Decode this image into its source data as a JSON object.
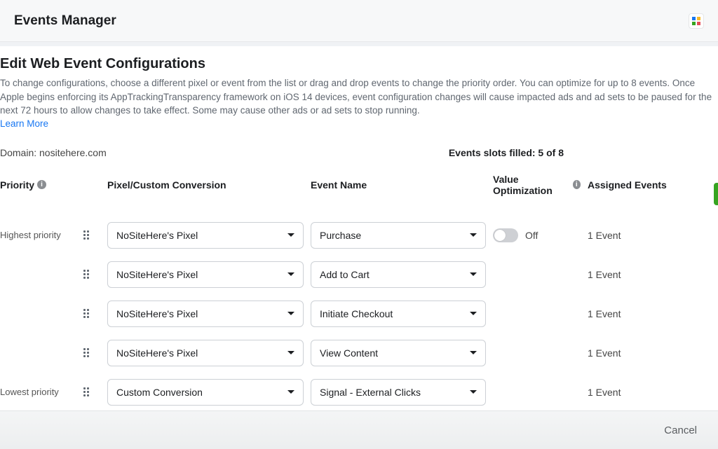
{
  "topbar": {
    "title": "Events Manager"
  },
  "panel": {
    "title": "Edit Web Event Configurations",
    "description": "To change configurations, choose a different pixel or event from the list or drag and drop events to change the priority order. You can optimize for up to 8 events. Once Apple begins enforcing its AppTrackingTransparency framework on iOS 14 devices, event configuration changes will cause impacted ads and ad sets to be paused for the next 72 hours to allow changes to take effect. Some may cause other ads or ad sets to stop running.",
    "learn_more": "Learn More",
    "domain_label": "Domain: nositehere.com",
    "slots_label": "Events slots filled: 5 of 8"
  },
  "columns": {
    "priority": "Priority",
    "pixel": "Pixel/Custom Conversion",
    "event": "Event Name",
    "value_opt": "Value Optimization",
    "assigned": "Assigned Events"
  },
  "priority_labels": {
    "highest": "Highest priority",
    "lowest": "Lowest priority"
  },
  "toggle": {
    "off": "Off"
  },
  "rows": [
    {
      "pixel": "NoSiteHere's Pixel",
      "event": "Purchase",
      "has_toggle": true,
      "assigned": "1 Event"
    },
    {
      "pixel": "NoSiteHere's Pixel",
      "event": "Add to Cart",
      "has_toggle": false,
      "assigned": "1 Event"
    },
    {
      "pixel": "NoSiteHere's Pixel",
      "event": "Initiate Checkout",
      "has_toggle": false,
      "assigned": "1 Event"
    },
    {
      "pixel": "NoSiteHere's Pixel",
      "event": "View Content",
      "has_toggle": false,
      "assigned": "1 Event"
    },
    {
      "pixel": "Custom Conversion",
      "event": "Signal - External Clicks",
      "has_toggle": false,
      "assigned": "1 Event"
    }
  ],
  "footer": {
    "cancel": "Cancel"
  }
}
